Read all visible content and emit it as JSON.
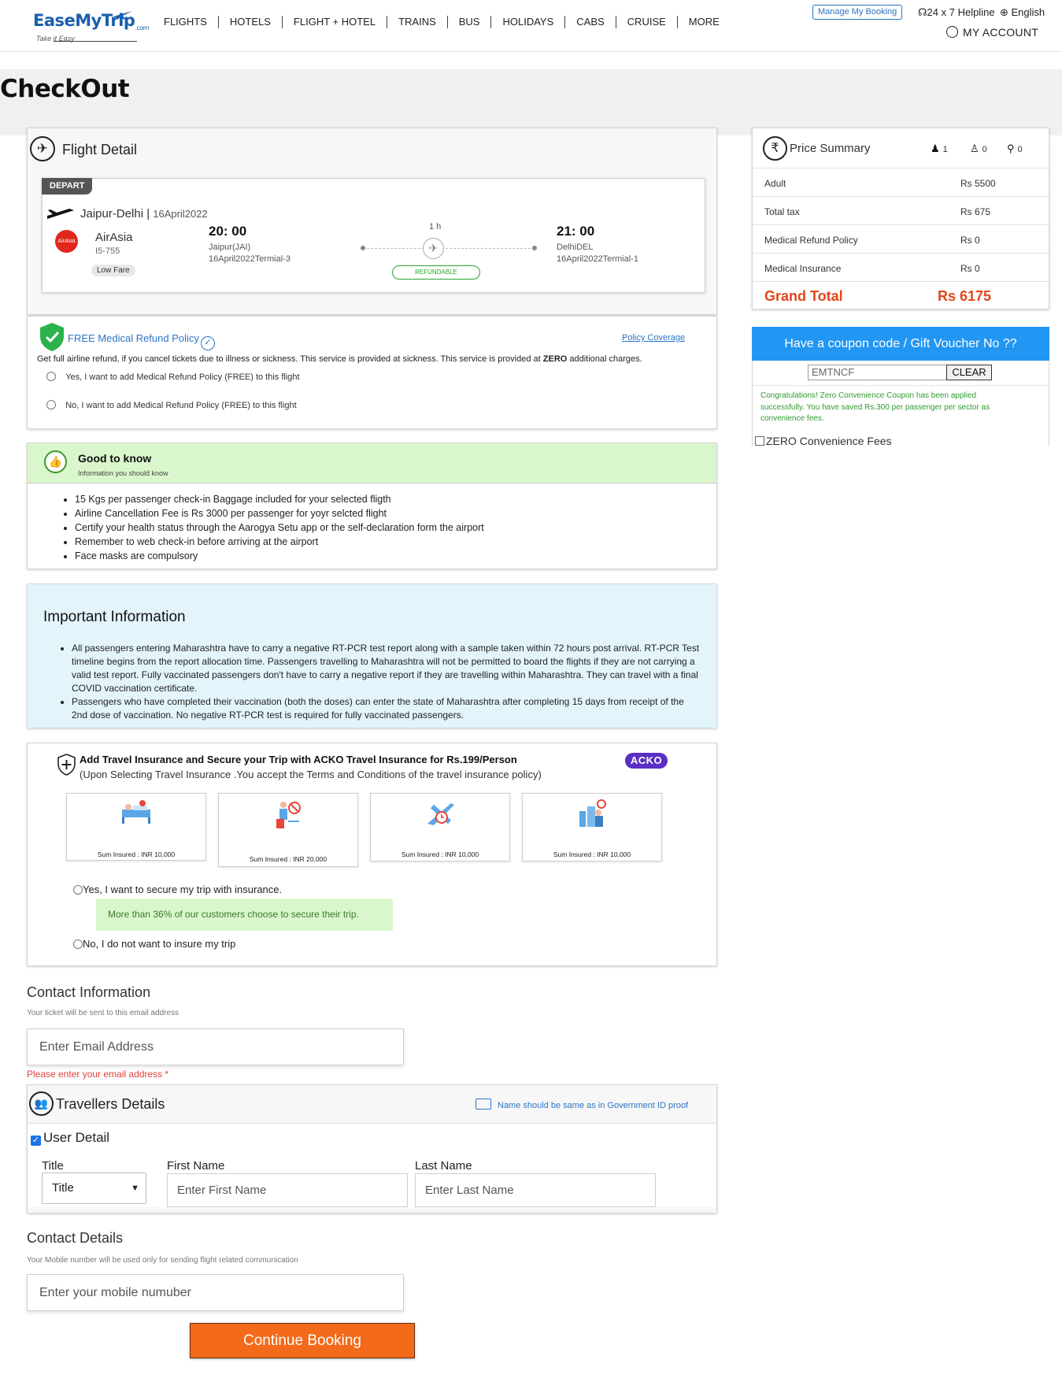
{
  "header": {
    "logo_text": "EaseMyTrip",
    "logo_suffix": ".com",
    "tagline": "Take it Easy",
    "nav": [
      "FLIGHTS",
      "HOTELS",
      "FLIGHT + HOTEL",
      "TRAINS",
      "BUS",
      "HOLIDAYS",
      "CABS",
      "CRUISE",
      "MORE"
    ],
    "manage_booking": "Manage My Booking",
    "helpline": "24 x 7 Helpline",
    "language": "English",
    "account": "MY ACCOUNT"
  },
  "page": {
    "title": "CheckOut"
  },
  "flight_detail": {
    "heading": "Flight Detail",
    "tag": "DEPART",
    "route": "Jaipur-Delhi",
    "date": "16April2022",
    "airline": "AirAsia",
    "airline_logo_text": "AirAsia",
    "flight_no": "I5-755",
    "fare_type": "Low Fare",
    "dep_time": "20: 00",
    "dep_airport": "Jaipur(JAI)",
    "dep_terminal": "16April2022Termial-3",
    "duration": "1 h",
    "refund_status": "REFUNDABLE",
    "arr_time": "21: 00",
    "arr_airport": "DelhiDEL",
    "arr_terminal": "16April2022Termial-1"
  },
  "medical_refund": {
    "title": "FREE Medical Refund Policy",
    "policy_link": "Policy Coverage",
    "description_plain": "Get full airline refund, if you cancel tickets due to illness or sickness. This service is provided at sickness. This service is provided at ",
    "description_bold": "ZERO",
    "description_end": " additional charges.",
    "option_yes": "Yes, I want to add Medical Refund Policy (FREE) to this flight",
    "option_no": "No, I want to add Medical Refund Policy (FREE) to this flight"
  },
  "good_to_know": {
    "title": "Good to know",
    "subtitle": "Information you should know",
    "items": [
      "15 Kgs per passenger check-in Baggage included for your selected fligth",
      "Airline Cancellation Fee is Rs 3000 per passenger for yoyr selcted flight",
      "Certify your health status through the Aarogya Setu app or the self-declaration form the airport",
      "Remember to web check-in before arriving at the airport",
      "Face masks are compulsory"
    ]
  },
  "important_info": {
    "title": "Important Information",
    "items": [
      "All passengers entering Maharashtra have to carry a negative RT-PCR test report along with a sample taken within 72 hours post arrival. RT-PCR Test timeline begins from the report allocation time. Passengers travelling to Maharashtra will not be permitted to board the flights if they are not carrying a valid test report. Fully vaccinated passengers don't have to carry a negative report if they are travelling within Maharashtra. They can travel with a final COVID vaccination certificate.",
      "Passengers who have completed their vaccination (both the doses) can enter the state of Maharashtra after completing 15 days from receipt of the 2nd dose of vaccination. No negative RT-PCR test is required for fully vaccinated passengers."
    ]
  },
  "insurance": {
    "title": "Add Travel Insurance and Secure your Trip with ACKO Travel Insurance for Rs.199/Person",
    "subtitle": "(Upon Selecting Travel Insurance .You accept the Terms and Conditions of the travel insurance policy)",
    "brand": "ACKO",
    "covers": [
      {
        "icon": "hospital-bed-icon",
        "label": "Sum Insured : INR 10,000"
      },
      {
        "icon": "lost-baggage-icon",
        "label": "Sum Insured : INR 20,000"
      },
      {
        "icon": "flight-delay-icon",
        "label": "Sum Insured : INR 10,000"
      },
      {
        "icon": "trip-cancel-icon",
        "label": "Sum Insured : INR 10,000"
      }
    ],
    "option_yes": "Yes, I want to secure my trip with insurance.",
    "note": "More than 36% of our customers choose to secure their trip.",
    "option_no": "No, I do not want to insure my trip"
  },
  "contact_info": {
    "title": "Contact Information",
    "subtitle": "Your ticket will be sent to this email address",
    "email_placeholder": "Enter Email Address",
    "error": "Please enter your email address *"
  },
  "travellers": {
    "title": "Travellers Details",
    "note": "Name should be same as in Government ID proof",
    "user_detail": "User Detail",
    "title_label": "Title",
    "title_value": "Title",
    "first_name_label": "First Name",
    "first_name_placeholder": "Enter First Name",
    "last_name_label": "Last Name",
    "last_name_placeholder": "Enter Last Name"
  },
  "contact_details": {
    "title": "Contact Details",
    "subtitle": "Your Mobile number will be used only for sending flight related communication",
    "mobile_placeholder": "Enter your mobile numuber",
    "continue": "Continue Booking"
  },
  "price_summary": {
    "title": "Price Summary",
    "adults": "1",
    "children": "0",
    "infants": "0",
    "rows": [
      {
        "label": "Adult",
        "value": "Rs 5500"
      },
      {
        "label": "Total tax",
        "value": "Rs 675"
      },
      {
        "label": "Medical Refund Policy",
        "value": "Rs 0"
      },
      {
        "label": "Medical Insurance",
        "value": "Rs 0"
      }
    ],
    "grand_label": "Grand Total",
    "grand_value": "Rs 6175"
  },
  "coupon": {
    "heading": "Have a coupon code / Gift Voucher No ??",
    "code": "EMTNCF",
    "clear": "CLEAR",
    "message": "Congratulations! Zero Convenience Coupon has been applied successfully. You have saved Rs.300 per passenger per sector as convenience fees.",
    "zero_fee": "ZERO Convenience Fees"
  }
}
